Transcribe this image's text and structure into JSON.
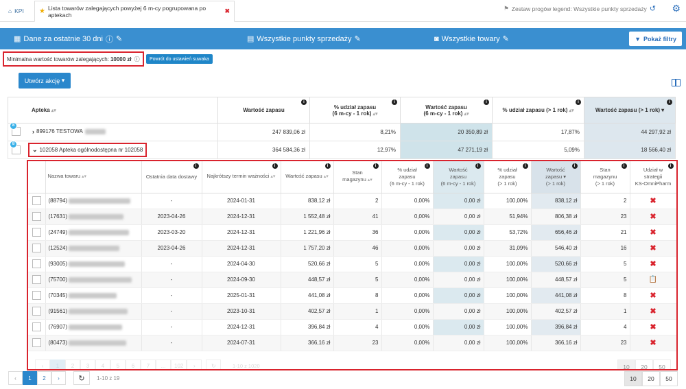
{
  "tabs": {
    "kpi": "KPI",
    "active": "Lista towarów zalegających powyżej 6 m-cy pogrupowana po aptekach"
  },
  "legend_set": "Zestaw progów legend: Wszystkie punkty sprzedaży",
  "filterbar": {
    "period": "Dane za ostatnie 30 dni",
    "points": "Wszystkie punkty sprzedaży",
    "products": "Wszystkie towary",
    "show_filters": "Pokaż filtry"
  },
  "min_value": {
    "label": "Minimalna wartość towarów zalegających:",
    "value": "10000 zł"
  },
  "reset_button": "Powrót do ustawień suwaka",
  "create_action": "Utwórz akcję",
  "outer_table": {
    "headers": [
      "Apteka",
      "Wartość zapasu",
      "% udział zapasu",
      "(6 m-cy - 1 rok)",
      "Wartość zapasu",
      "(6 m-cy - 1 rok)",
      "% udział zapasu (> 1 rok)",
      "Wartość zapasu (> 1 rok)"
    ],
    "rows": [
      {
        "badge": "8",
        "name": "899176 TESTOWA",
        "value": "247 839,06 zł",
        "pct_6m": "8,21%",
        "val_6m": "20 350,89 zł",
        "pct_1y": "17,87%",
        "val_1y": "44 297,92 zł"
      },
      {
        "badge": "8",
        "name": "102058 Apteka ogólnodostępna nr 102058",
        "value": "364 584,36 zł",
        "pct_6m": "12,97%",
        "val_6m": "47 271,19 zł",
        "pct_1y": "5,09%",
        "val_1y": "18 566,40 zł"
      }
    ]
  },
  "inner_table": {
    "headers": {
      "name": "Nazwa towaru",
      "last_delivery": "Ostatnia data dostawy",
      "expiry": "Najkrótszy termin ważności",
      "value": "Wartość zapasu",
      "stock1": "Stan",
      "stock2": "magazynu",
      "p6a": "% udział",
      "p6b": "zapasu",
      "p6c": "(6 m-cy - 1 rok)",
      "v6a": "Wartość",
      "v6b": "zapasu",
      "v6c": "(6 m-cy - 1 rok)",
      "p1a": "% udział",
      "p1b": "zapasu",
      "p1c": "(> 1 rok)",
      "v1a": "Wartość",
      "v1b": "zapasu",
      "v1c": "(> 1 rok)",
      "s1a": "Stan",
      "s1b": "magazynu",
      "s1c": "(> 1 rok)",
      "stra": "Udział w",
      "strb": "strategii",
      "strc": "KS-OmniPharm"
    },
    "rows": [
      {
        "code": "(88794)",
        "last": "-",
        "exp": "2024-01-31",
        "value": "838,12 zł",
        "stock": "2",
        "p6": "0,00%",
        "v6": "0,00 zł",
        "p1": "100,00%",
        "v1": "838,12 zł",
        "s1": "2",
        "strategy": "x"
      },
      {
        "code": "(17631)",
        "last": "2023-04-26",
        "exp": "2024-12-31",
        "value": "1 552,48 zł",
        "stock": "41",
        "p6": "0,00%",
        "v6": "0,00 zł",
        "p1": "51,94%",
        "v1": "806,38 zł",
        "s1": "23",
        "strategy": "x"
      },
      {
        "code": "(24749)",
        "last": "2023-03-20",
        "exp": "2024-12-31",
        "value": "1 221,96 zł",
        "stock": "36",
        "p6": "0,00%",
        "v6": "0,00 zł",
        "p1": "53,72%",
        "v1": "656,46 zł",
        "s1": "21",
        "strategy": "x"
      },
      {
        "code": "(12524)",
        "last": "2023-04-26",
        "exp": "2024-12-31",
        "value": "1 757,20 zł",
        "stock": "46",
        "p6": "0,00%",
        "v6": "0,00 zł",
        "p1": "31,09%",
        "v1": "546,40 zł",
        "s1": "16",
        "strategy": "x"
      },
      {
        "code": "(93005)",
        "last": "-",
        "exp": "2024-04-30",
        "value": "520,66 zł",
        "stock": "5",
        "p6": "0,00%",
        "v6": "0,00 zł",
        "p1": "100,00%",
        "v1": "520,66 zł",
        "s1": "5",
        "strategy": "x"
      },
      {
        "code": "(75700)",
        "last": "-",
        "exp": "2024-09-30",
        "value": "448,57 zł",
        "stock": "5",
        "p6": "0,00%",
        "v6": "0,00 zł",
        "p1": "100,00%",
        "v1": "448,57 zł",
        "s1": "5",
        "strategy": "doc"
      },
      {
        "code": "(70345)",
        "last": "-",
        "exp": "2025-01-31",
        "value": "441,08 zł",
        "stock": "8",
        "p6": "0,00%",
        "v6": "0,00 zł",
        "p1": "100,00%",
        "v1": "441,08 zł",
        "s1": "8",
        "strategy": "x"
      },
      {
        "code": "(91561)",
        "last": "-",
        "exp": "2023-10-31",
        "value": "402,57 zł",
        "stock": "1",
        "p6": "0,00%",
        "v6": "0,00 zł",
        "p1": "100,00%",
        "v1": "402,57 zł",
        "s1": "1",
        "strategy": "x"
      },
      {
        "code": "(76907)",
        "last": "-",
        "exp": "2024-12-31",
        "value": "396,84 zł",
        "stock": "4",
        "p6": "0,00%",
        "v6": "0,00 zł",
        "p1": "100,00%",
        "v1": "396,84 zł",
        "s1": "4",
        "strategy": "x"
      },
      {
        "code": "(80473)",
        "last": "-",
        "exp": "2024-07-31",
        "value": "366,16 zł",
        "stock": "23",
        "p6": "0,00%",
        "v6": "0,00 zł",
        "p1": "100,00%",
        "v1": "366,16 zł",
        "s1": "23",
        "strategy": "x"
      }
    ]
  },
  "inner_pagination": {
    "pages": [
      "‹",
      "1",
      "2",
      "3",
      "4",
      "5",
      "6",
      "7",
      "...",
      "102",
      "›"
    ],
    "info": "1-10 z 1020",
    "sizes": [
      "10",
      "20",
      "50"
    ]
  },
  "outer_pagination": {
    "pages": [
      "‹",
      "1",
      "2",
      "›"
    ],
    "info": "1-10 z 19",
    "sizes": [
      "10",
      "20",
      "50"
    ]
  },
  "icons": {
    "kpi": "home-icon",
    "star": "star-icon",
    "flag": "flag-icon",
    "undo": "undo-icon",
    "gear": "gear-icon",
    "calendar": "calendar-icon",
    "edit": "edit-icon",
    "store": "store-icon",
    "camera": "camera-icon",
    "filter": "filter-icon",
    "delete": "close-icon",
    "doc": "document-icon",
    "refresh": "refresh-icon",
    "columns": "columns-icon"
  },
  "colors": {
    "accent": "#3a8fd0",
    "highlight": "#d9232d",
    "teal_col": "#cfe3ea"
  }
}
